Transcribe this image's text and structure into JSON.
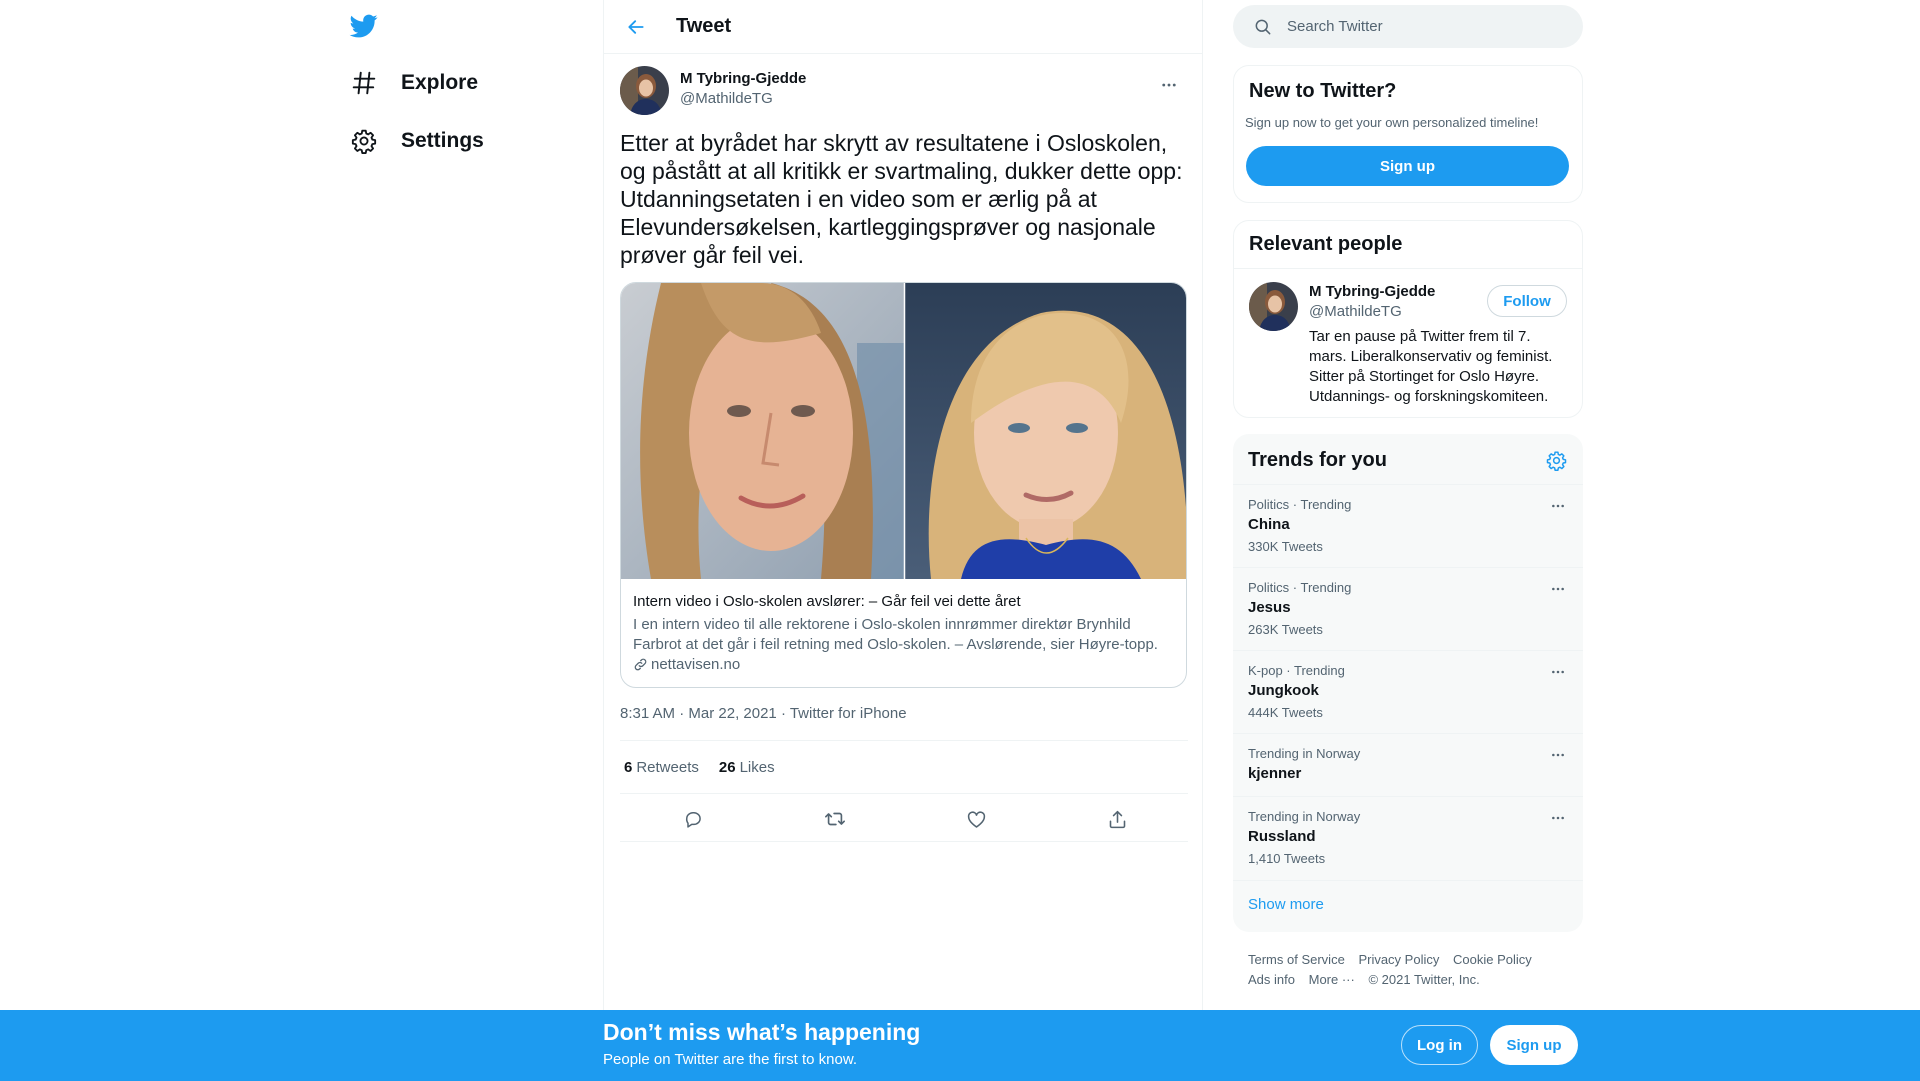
{
  "nav": {
    "logo_icon": "twitter-bird-icon",
    "items": [
      {
        "label": "Explore",
        "icon": "hashtag-icon"
      },
      {
        "label": "Settings",
        "icon": "gear-icon"
      }
    ]
  },
  "header": {
    "title": "Tweet",
    "back_icon": "back-arrow-icon"
  },
  "tweet": {
    "author_name": "M Tybring-Gjedde",
    "author_handle": "@MathildeTG",
    "text": "Etter at byrådet har skrytt av resultatene i Osloskolen,\nog påstått at all kritikk er svartmaling, dukker dette opp:\nUtdanningsetaten i en video som er ærlig på at\nElevundersøkelsen, kartleggingsprøver og nasjonale\nprøver går feil vei.",
    "card": {
      "title": "Intern video i Oslo-skolen avslører: – Går feil vei dette året",
      "description": "I en intern video til alle rektorene i Oslo-skolen innrømmer direktør Brynhild Farbrot at det går i feil retning med Oslo-skolen. – Avslørende, sier Høyre-topp.",
      "domain": "nettavisen.no"
    },
    "time": "8:31 AM",
    "date": "Mar 22, 2021",
    "source": "Twitter for iPhone",
    "sep": " · ",
    "retweets_count": "6",
    "retweets_label": "Retweets",
    "likes_count": "26",
    "likes_label": "Likes"
  },
  "sidebar": {
    "search_placeholder": "Search Twitter",
    "new_to_twitter": {
      "title": "New to Twitter?",
      "subtitle": "Sign up now to get your own personalized timeline!",
      "button": "Sign up"
    },
    "relevant_people": {
      "title": "Relevant people",
      "name": "M Tybring-Gjedde",
      "handle": "@MathildeTG",
      "follow_label": "Follow",
      "bio": "Tar en pause på Twitter frem til 7. mars. Liberalkonservativ og feminist. Sitter på Stortinget for Oslo Høyre. Utdannings- og forskningskomiteen."
    },
    "trends": {
      "title": "Trends for you",
      "items": [
        {
          "context": "Politics · Trending",
          "name": "China",
          "count": "330K Tweets"
        },
        {
          "context": "Politics · Trending",
          "name": "Jesus",
          "count": "263K Tweets"
        },
        {
          "context": "K-pop · Trending",
          "name": "Jungkook",
          "count": "444K Tweets"
        },
        {
          "context": "Trending in Norway",
          "name": "kjenner",
          "count": ""
        },
        {
          "context": "Trending in Norway",
          "name": "Russland",
          "count": "1,410 Tweets"
        }
      ],
      "show_more": "Show more"
    },
    "footer": {
      "terms": "Terms of Service",
      "privacy": "Privacy Policy",
      "cookie": "Cookie Policy",
      "ads": "Ads info",
      "more": "More ···",
      "copyright": "© 2021 Twitter, Inc."
    }
  },
  "bottom_bar": {
    "title": "Don’t miss what’s happening",
    "subtitle": "People on Twitter are the first to know.",
    "login": "Log in",
    "signup": "Sign up"
  },
  "colors": {
    "accent": "#1d9bf0",
    "text": "#0f1419",
    "secondary": "#536471"
  }
}
